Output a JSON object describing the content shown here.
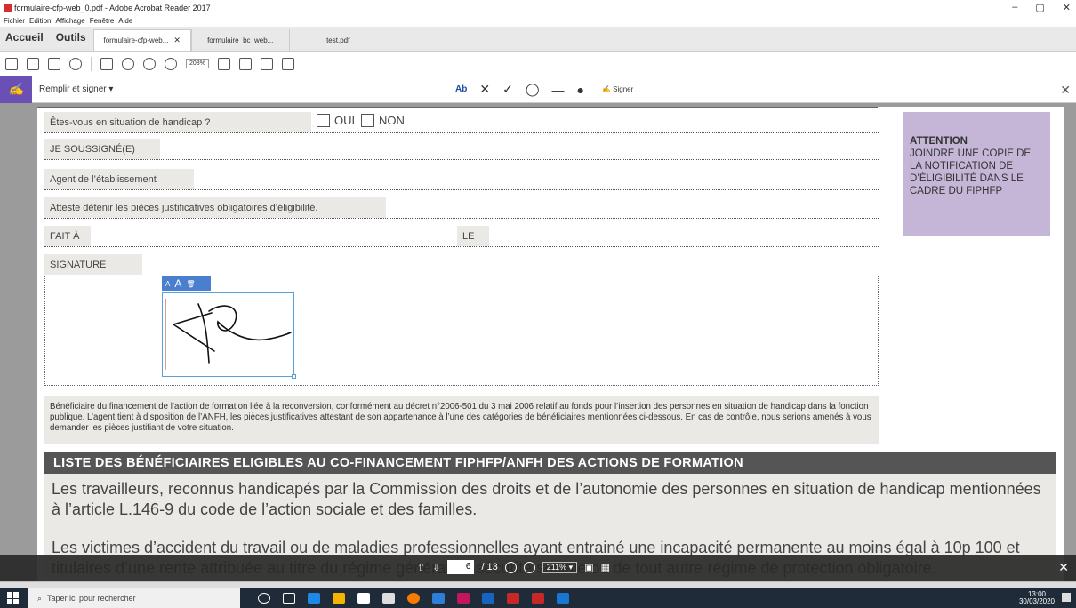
{
  "window": {
    "title": "formulaire-cfp-web_0.pdf - Adobe Acrobat Reader 2017"
  },
  "menu": [
    "Fichier",
    "Edition",
    "Affichage",
    "Fenêtre",
    "Aide"
  ],
  "nav_tabs": {
    "home": "Accueil",
    "tools": "Outils"
  },
  "doc_tabs": [
    {
      "label": "formulaire-cfp-web...",
      "active": true
    },
    {
      "label": "formulaire_bc_web...",
      "active": false
    },
    {
      "label": "test.pdf",
      "active": false
    }
  ],
  "toolbar": {
    "zoom": "208%"
  },
  "fill_sign": {
    "label": "Remplir et signer",
    "text_tool": "Ab",
    "sign_label": "Signer"
  },
  "form": {
    "handicap_q": "Êtes-vous en situation de handicap ?",
    "oui": "OUI",
    "non": "NON",
    "soussigne": "JE SOUSSIGNÉ(E)",
    "agent": "Agent de l’établissement",
    "atteste": "Atteste détenir les pièces justificatives obligatoires d’éligibilité.",
    "fait_a": "FAIT À",
    "le": "LE",
    "signature": "SIGNATURE"
  },
  "attention": {
    "heading": "ATTENTION",
    "body": "JOINDRE UNE COPIE DE LA NOTIFICATION DE D’ÉLIGIBILITÉ DANS LE CADRE DU FIPHFP"
  },
  "sig_tools": {
    "small_a": "A",
    "big_a": "A"
  },
  "info_text": "Bénéficiaire du financement de l’action de formation liée à la reconversion, conformément au décret n°2006-501 du 3 mai 2006 relatif au fonds pour l’insertion des personnes en situation de handicap dans la fonction publique. L’agent tient à disposition de l’ANFH, les pièces justificatives attestant de son appartenance à l’une des catégories de bénéficiaires mentionnées ci-dessous. En cas de contrôle, nous serions amenés à vous demander les pièces justifiant de votre situation.",
  "list": {
    "heading": "LISTE DES BÉNÉFICIAIRES ELIGIBLES AU CO-FINANCEMENT FIPHFP/ANFH DES ACTIONS DE FORMATION",
    "p1": "Les travailleurs, reconnus handicapés par la Commission des droits et de l’autonomie des personnes en situation de handicap mentionnées à l’article L.146-9 du code de l’action sociale et des familles.",
    "p2": "Les victimes d’accident du travail ou de maladies professionnelles ayant entrainé une incapacité permanente au moins égal à 10p 100 et titulaires d’une rente attribuée au titre du régime général de sécurité sociale ou de tout autre régime de protection obligatoire."
  },
  "page_nav": {
    "current": "6",
    "total": "/ 13",
    "zoom": "211%"
  },
  "taskbar": {
    "search_placeholder": "Taper ici pour rechercher",
    "time": "13:00",
    "date": "30/03/2020"
  },
  "colors": {
    "accent": "#6a4fb5",
    "attention_bg": "#c5b6d7",
    "header_bg": "#555555"
  }
}
